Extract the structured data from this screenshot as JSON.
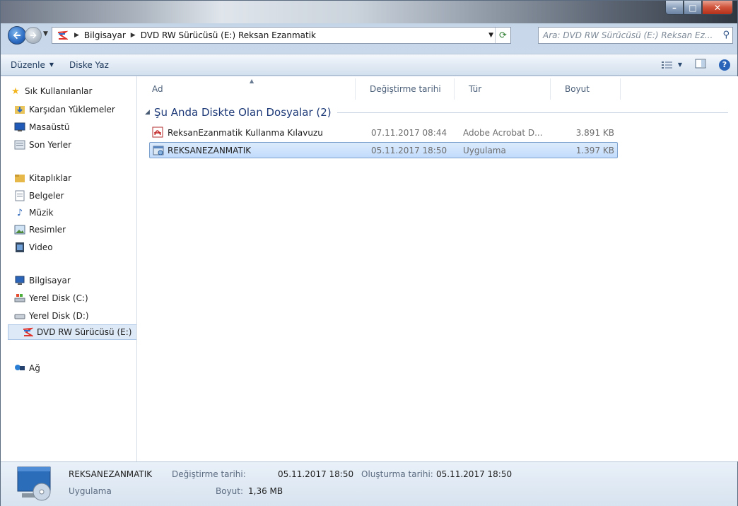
{
  "window": {
    "title_buttons": [
      "–",
      "□",
      "✕"
    ]
  },
  "nav": {
    "breadcrumbs": [
      "Bilgisayar",
      "DVD RW Sürücüsü (E:) Reksan Ezanmatik"
    ],
    "search_placeholder": "Ara: DVD RW Sürücüsü (E:) Reksan Ez..."
  },
  "toolbar": {
    "organize": "Düzenle",
    "burn": "Diske Yaz"
  },
  "sidebar": {
    "favorites": {
      "label": "Sık Kullanılanlar",
      "items": [
        "Karşıdan Yüklemeler",
        "Masaüstü",
        "Son Yerler"
      ]
    },
    "libraries": {
      "label": "Kitaplıklar",
      "items": [
        "Belgeler",
        "Müzik",
        "Resimler",
        "Video"
      ]
    },
    "computer": {
      "label": "Bilgisayar",
      "items": [
        "Yerel Disk (C:)",
        "Yerel Disk (D:)",
        "DVD RW Sürücüsü (E:)"
      ]
    },
    "network": {
      "label": "Ağ"
    }
  },
  "columns": {
    "name": "Ad",
    "date": "Değiştirme tarihi",
    "type": "Tür",
    "size": "Boyut"
  },
  "group": {
    "title": "Şu Anda Diskte Olan Dosyalar (2)"
  },
  "files": [
    {
      "name": "ReksanEzanmatik Kullanma Kılavuzu",
      "date": "07.11.2017 08:44",
      "type": "Adobe Acrobat D...",
      "size": "3.891 KB",
      "icon": "pdf-icon"
    },
    {
      "name": "REKSANEZANMATIK",
      "date": "05.11.2017 18:50",
      "type": "Uygulama",
      "size": "1.397 KB",
      "icon": "application-icon"
    }
  ],
  "details": {
    "name": "REKSANEZANMATIK",
    "type": "Uygulama",
    "modified_label": "Değiştirme tarihi:",
    "modified": "05.11.2017 18:50",
    "size_label": "Boyut:",
    "size": "1,36 MB",
    "created_label": "Oluşturma tarihi:",
    "created": "05.11.2017 18:50"
  }
}
